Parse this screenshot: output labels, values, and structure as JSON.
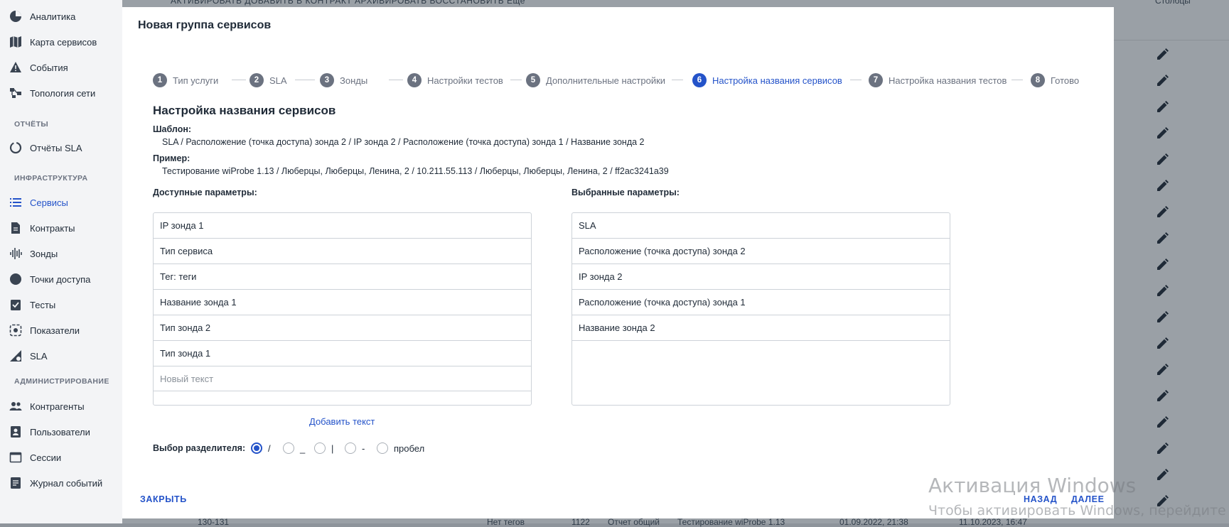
{
  "sidebar": {
    "items_top": [
      {
        "label": "Аналитика",
        "icon": "pie-chart-icon"
      },
      {
        "label": "Карта сервисов",
        "icon": "map-icon"
      },
      {
        "label": "События",
        "icon": "warning-icon"
      },
      {
        "label": "Топология сети",
        "icon": "topology-icon"
      }
    ],
    "section_reports": "ОТЧЁТЫ",
    "reports_items": [
      {
        "label": "Отчёты SLA",
        "icon": "circle-progress-icon"
      }
    ],
    "section_infra": "ИНФРАСТРУКТУРА",
    "infra_items": [
      {
        "label": "Сервисы",
        "icon": "list-icon",
        "active": true
      },
      {
        "label": "Контракты",
        "icon": "document-icon"
      },
      {
        "label": "Зонды",
        "icon": "signal-icon"
      },
      {
        "label": "Точки доступа",
        "icon": "dot-icon"
      },
      {
        "label": "Тесты",
        "icon": "checklist-icon"
      },
      {
        "label": "Показатели",
        "icon": "gauge-icon"
      },
      {
        "label": "SLA",
        "icon": "sla-icon"
      }
    ],
    "section_admin": "АДМИНИСТРИРОВАНИЕ",
    "admin_items": [
      {
        "label": "Контрагенты",
        "icon": "people-icon"
      },
      {
        "label": "Пользователи",
        "icon": "user-card-icon"
      },
      {
        "label": "Сессии",
        "icon": "window-icon"
      },
      {
        "label": "Журнал событий",
        "icon": "log-icon"
      }
    ]
  },
  "background": {
    "toolbar_text": "АКТИВИРОВАТЬ   ДОБАВИТЬ В КОНТРАКТ   АРХИВИРОВАТЬ   ВОССТАНОВИТЬ   Еще",
    "columns_label": "Столбцы",
    "bottom_row": {
      "c1": "130-131",
      "c2": "Нет тегов",
      "c3": "1122",
      "c4": "Отчет общий",
      "c5": "Тестирование wiProbe 1.13",
      "c6": "01.09.2022, 21:38",
      "c7": "11.10.2023, 16:47"
    }
  },
  "modal": {
    "title": "Новая группа сервисов",
    "steps": [
      {
        "num": "1",
        "label": "Тип услуги"
      },
      {
        "num": "2",
        "label": "SLA"
      },
      {
        "num": "3",
        "label": "Зонды"
      },
      {
        "num": "4",
        "label": "Настройки тестов"
      },
      {
        "num": "5",
        "label": "Дополнительные настройки"
      },
      {
        "num": "6",
        "label": "Настройка названия сервисов",
        "active": true
      },
      {
        "num": "7",
        "label": "Настройка названия тестов"
      },
      {
        "num": "8",
        "label": "Готово"
      }
    ],
    "section_title": "Настройка названия сервисов",
    "template_label": "Шаблон:",
    "template_value": "SLA / Расположение (точка доступа) зонда 2 / IP зонда 2 / Расположение (точка доступа) зонда 1 / Название зонда 2",
    "example_label": "Пример:",
    "example_value": "Тестирование wiProbe 1.13 / Люберцы, Люберцы, Ленина, 2 / 10.211.55.113 / Люберцы, Люберцы, Ленина, 2 / ff2ac3241a39",
    "available_label": "Доступные параметры:",
    "selected_label": "Выбранные параметры:",
    "available": [
      "IP зонда 1",
      "Тип сервиса",
      "Тег: теги",
      "Название зонда 1",
      "Тип зонда 2",
      "Тип зонда 1"
    ],
    "new_text_placeholder": "Новый текст",
    "selected": [
      "SLA",
      "Расположение (точка доступа) зонда 2",
      "IP зонда 2",
      "Расположение (точка доступа) зонда 1",
      "Название зонда 2"
    ],
    "add_text": "Добавить текст",
    "separator_label": "Выбор разделителя:",
    "separators": [
      {
        "label": "/",
        "checked": true
      },
      {
        "label": "_",
        "checked": false
      },
      {
        "label": "|",
        "checked": false
      },
      {
        "label": "-",
        "checked": false
      },
      {
        "label": "пробел",
        "checked": false
      }
    ],
    "close_button": "ЗАКРЫТЬ",
    "back_button": "НАЗАД",
    "next_button": "ДАЛЕЕ"
  },
  "watermark": {
    "line1": "Активация Windows",
    "line2": "Чтобы активировать Windows, перейдите"
  }
}
